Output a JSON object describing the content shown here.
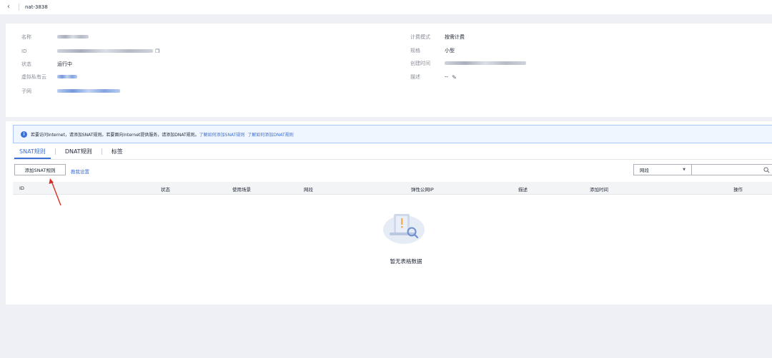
{
  "topbar": {
    "back_icon": "chevron-left-icon",
    "title": "nat-3838"
  },
  "info": {
    "name_label": "名称",
    "id_label": "ID",
    "status_label": "状态",
    "status_value": "运行中",
    "vpc_label": "虚拟私有云",
    "subnet_label": "子网",
    "billing_label": "计费模式",
    "billing_value": "按需计费",
    "spec_label": "规格",
    "spec_value": "小型",
    "created_label": "创建时间",
    "desc_label": "描述",
    "desc_value": "--"
  },
  "notice": {
    "text": "若要访问Internet，请添加SNAT规则。若要面向Internet提供服务，请添加DNAT规则。",
    "link1": "了解如何添加SNAT规则",
    "link2": "了解如何添加DNAT规则"
  },
  "tabs": [
    {
      "label": "SNAT规则"
    },
    {
      "label": "DNAT规则"
    },
    {
      "label": "标签"
    }
  ],
  "toolbar": {
    "add_button": "添加SNAT规则",
    "quick_link": "教我设置",
    "filter_select": "网段"
  },
  "table": {
    "headers": [
      "ID",
      "状态",
      "使用场景",
      "网段",
      "弹性公网IP",
      "描述",
      "添加时间",
      "操作"
    ],
    "empty_text": "暂无表格数据"
  },
  "colors": {
    "accent": "#3a6fd8",
    "arrow": "#d93026"
  }
}
